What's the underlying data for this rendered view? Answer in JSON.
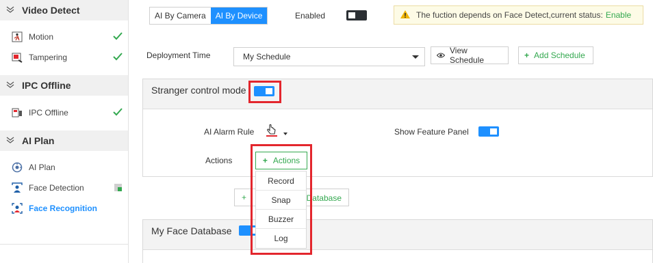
{
  "sidebar": {
    "groups": [
      {
        "title": "Video Detect",
        "items": [
          {
            "label": "Motion",
            "icon": "motion-icon",
            "status": "check"
          },
          {
            "label": "Tampering",
            "icon": "tampering-icon",
            "status": "check"
          }
        ]
      },
      {
        "title": "IPC Offline",
        "items": [
          {
            "label": "IPC Offline",
            "icon": "ipc-offline-icon",
            "status": "check"
          }
        ]
      },
      {
        "title": "AI Plan",
        "items": [
          {
            "label": "AI Plan",
            "icon": "ai-plan-icon"
          },
          {
            "label": "Face Detection",
            "icon": "face-detection-icon",
            "status": "partial"
          },
          {
            "label": "Face Recognition",
            "icon": "face-recognition-icon",
            "active": true
          }
        ]
      }
    ]
  },
  "topbar": {
    "tabs": [
      {
        "label": "AI By Camera",
        "active": false
      },
      {
        "label": "AI By Device",
        "active": true
      }
    ],
    "enabled_label": "Enabled",
    "enabled_on": false,
    "notice_text": "The fuction depends on Face Detect,current status:",
    "notice_status": "Enable"
  },
  "deployment": {
    "label": "Deployment Time",
    "schedule_value": "My Schedule",
    "view_schedule_label": "View Schedule",
    "add_schedule_label": "Add Schedule"
  },
  "stranger_panel": {
    "title": "Stranger control mode",
    "enabled": true,
    "ai_alarm_rule_label": "AI Alarm Rule",
    "show_feature_panel_label": "Show Feature Panel",
    "show_feature_panel_on": true,
    "actions_label": "Actions",
    "actions_button_label": "Actions",
    "actions_menu": [
      "Record",
      "Snap",
      "Buzzer",
      "Log"
    ]
  },
  "add_database_button": {
    "visible_label": "Database"
  },
  "face_db_panel": {
    "title": "My Face Database",
    "enabled": true
  },
  "colors": {
    "accent": "#1e90ff",
    "success": "#33a84f",
    "highlight": "#e3262d",
    "warning_bg": "#fdfbe6"
  }
}
